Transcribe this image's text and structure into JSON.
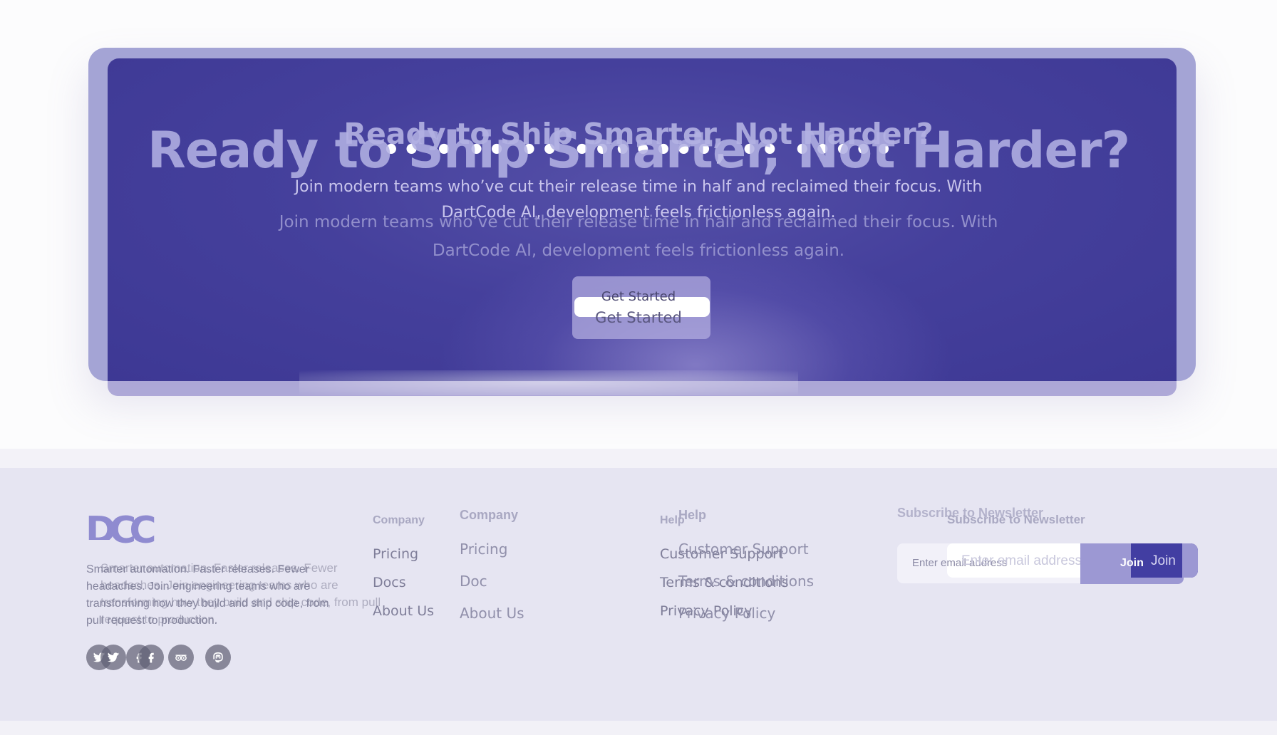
{
  "cta": {
    "headline": "Ready to Ship Smarter, Not Harder?",
    "headline_echo": "Ready to Ship Smarter, Not Harder?",
    "headline_dots": "•• • •• •• •••••••, •• •••••",
    "description_line1": "Join modern teams who’ve cut their release time in half and reclaimed their focus. With",
    "description_line2": "DartCode AI, development feels frictionless again.",
    "button_label": "Get Started",
    "button_label_echo": "Get Started"
  },
  "footer": {
    "logo_text": "DCC",
    "tagline": "Smarter automation. Faster releases. Fewer headaches. Join engineering teams who are transforming how they build and ship code, from pull request to production.",
    "tagline_echo": "Smarter automation. Faster releases. Fewer headaches. Join engineering teams who are transforming how they build and ship code, from pull request to production.",
    "social": [
      {
        "name": "twitter-icon"
      },
      {
        "name": "twitter-icon"
      },
      {
        "name": "facebook-icon"
      },
      {
        "name": "facebook-icon"
      },
      {
        "name": "tripadvisor-icon"
      },
      {
        "name": "mastodon-icon"
      }
    ],
    "company": {
      "title": "Company",
      "title_echo": "Company",
      "links": [
        "Pricing",
        "Docs",
        "About Us"
      ],
      "links_echo": [
        "Pricing",
        "Doc",
        "About Us"
      ]
    },
    "help": {
      "title": "Help",
      "title_echo": "Help",
      "links": [
        "Customer Support",
        "Terms & conditions",
        "Privacy Policy"
      ],
      "links_echo": [
        "Customer Support",
        "Terms & conditions",
        "Privacy Policy"
      ]
    },
    "newsletter": {
      "title": "Subscribe to Newsletter",
      "title_echo": "Subscribe to Newsletter",
      "email_placeholder": "Enter email address",
      "email_placeholder_echo": "Enter email address",
      "join_label": "Join",
      "join_label_echo": "Join"
    }
  },
  "colors": {
    "accent": "#423ea2",
    "banner": "#45409c",
    "footer_bg": "#e6e5f2"
  }
}
